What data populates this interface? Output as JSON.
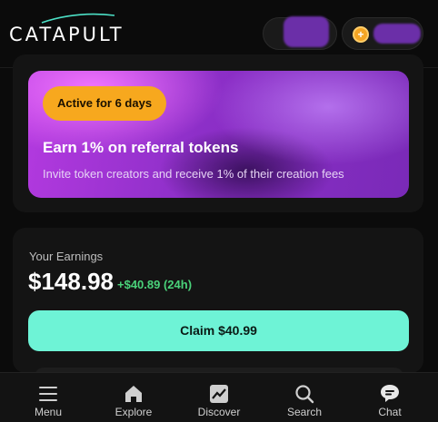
{
  "header": {
    "logo_text": "CATAPULT",
    "user_pill": {
      "redacted": true
    },
    "balance_pill": {
      "redacted": true,
      "coin_icon": "coin-icon"
    }
  },
  "referral": {
    "badge": "Active for 6 days",
    "title": "Earn 1% on referral tokens",
    "subtitle": "Invite token creators and receive 1% of their creation fees"
  },
  "earnings": {
    "label": "Your Earnings",
    "amount": "$148.98",
    "change": "+$40.89 (24h)",
    "claim_label": "Claim $40.99"
  },
  "nav": {
    "items": [
      {
        "label": "Menu",
        "icon": "menu-icon"
      },
      {
        "label": "Explore",
        "icon": "home-icon"
      },
      {
        "label": "Discover",
        "icon": "chart-icon"
      },
      {
        "label": "Search",
        "icon": "search-icon"
      },
      {
        "label": "Chat",
        "icon": "chat-icon"
      }
    ]
  },
  "colors": {
    "accent_claim": "#6ef3d6",
    "badge": "#f7a81e",
    "positive": "#4ad27a",
    "banner": "#8d2fc8"
  }
}
